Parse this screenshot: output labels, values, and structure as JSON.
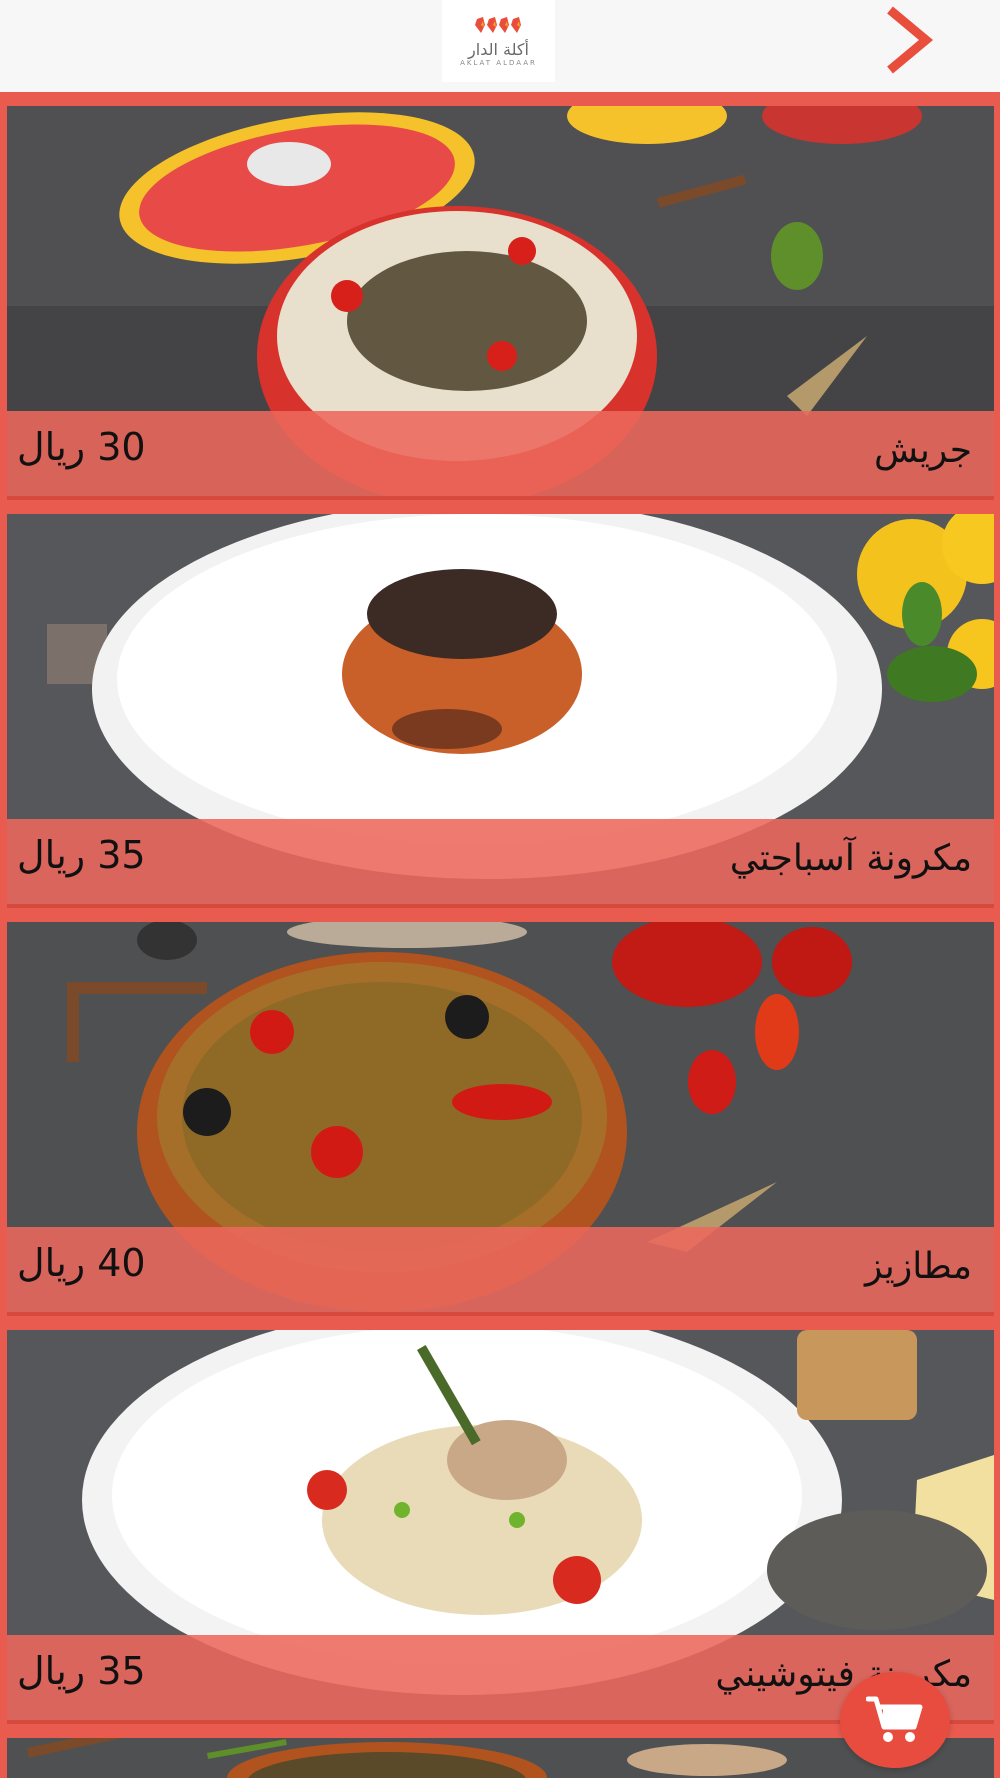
{
  "header": {
    "logo_arabic": "أكلة الدار",
    "logo_english": "AKLAT ALDAAR",
    "back_icon": "chevron-right-icon"
  },
  "menu": {
    "items": [
      {
        "name": "جريش",
        "price": "30 ريال"
      },
      {
        "name": "مكرونة آسباجتي",
        "price": "35 ريال"
      },
      {
        "name": "مطازيز",
        "price": "40 ريال"
      },
      {
        "name": "مكرونة فيتوشيني",
        "price": "35 ريال"
      }
    ]
  },
  "cart": {
    "icon": "shopping-cart-icon"
  },
  "colors": {
    "accent": "#e95b4e",
    "caption": "#ec685c",
    "background": "#f7f7f7"
  }
}
